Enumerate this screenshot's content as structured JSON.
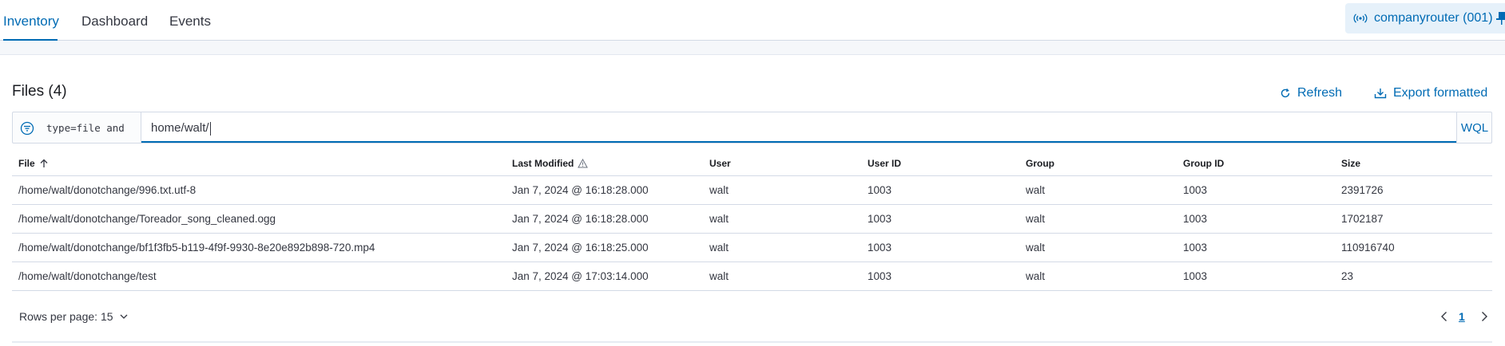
{
  "tabs": [
    {
      "label": "Inventory",
      "active": true
    },
    {
      "label": "Dashboard",
      "active": false
    },
    {
      "label": "Events",
      "active": false
    }
  ],
  "agent": {
    "label": "companyrouter (001)",
    "icon": "antenna-icon"
  },
  "panel": {
    "title": "Files (4)"
  },
  "actions": {
    "refresh_label": "Refresh",
    "export_label": "Export formatted"
  },
  "search": {
    "prefix": "type=file and",
    "value": "home/walt/",
    "wql_label": "WQL"
  },
  "table": {
    "columns": [
      "File",
      "Last Modified",
      "User",
      "User ID",
      "Group",
      "Group ID",
      "Size"
    ],
    "rows": [
      [
        "/home/walt/donotchange/996.txt.utf-8",
        "Jan 7, 2024 @ 16:18:28.000",
        "walt",
        "1003",
        "walt",
        "1003",
        "2391726"
      ],
      [
        "/home/walt/donotchange/Toreador_song_cleaned.ogg",
        "Jan 7, 2024 @ 16:18:28.000",
        "walt",
        "1003",
        "walt",
        "1003",
        "1702187"
      ],
      [
        "/home/walt/donotchange/bf1f3fb5-b119-4f9f-9930-8e20e892b898-720.mp4",
        "Jan 7, 2024 @ 16:18:25.000",
        "walt",
        "1003",
        "walt",
        "1003",
        "110916740"
      ],
      [
        "/home/walt/donotchange/test",
        "Jan 7, 2024 @ 17:03:14.000",
        "walt",
        "1003",
        "walt",
        "1003",
        "23"
      ]
    ]
  },
  "pagination": {
    "rows_per_page_label": "Rows per page: 15",
    "current_page": "1"
  },
  "colors": {
    "accent": "#006bb4",
    "text": "#343741",
    "border": "#d3dae6",
    "agent_bg": "#e6f1fa"
  }
}
